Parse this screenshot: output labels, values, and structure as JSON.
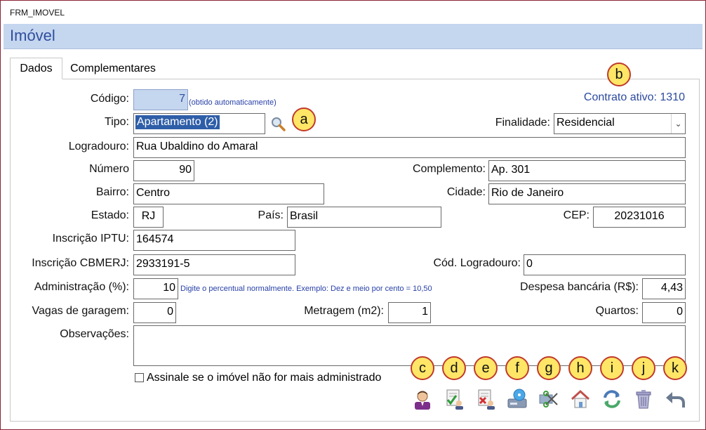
{
  "window": {
    "caption": "FRM_IMOVEL",
    "title": "Imóvel"
  },
  "tabs": [
    {
      "label": "Dados"
    },
    {
      "label": "Complementares"
    }
  ],
  "contract": {
    "text": "Contrato ativo: 1310"
  },
  "form": {
    "codigo": {
      "label": "Código:",
      "value": "7",
      "hint": "(obtido automaticamente)"
    },
    "tipo": {
      "label": "Tipo:",
      "value": "Apartamento (2)"
    },
    "finalidade": {
      "label": "Finalidade:",
      "value": "Residencial"
    },
    "logradouro": {
      "label": "Logradouro:",
      "value": "Rua Ubaldino do Amaral"
    },
    "numero": {
      "label": "Número",
      "value": "90"
    },
    "complemento": {
      "label": "Complemento:",
      "value": "Ap. 301"
    },
    "bairro": {
      "label": "Bairro:",
      "value": "Centro"
    },
    "cidade": {
      "label": "Cidade:",
      "value": "Rio de Janeiro"
    },
    "estado": {
      "label": "Estado:",
      "value": "RJ"
    },
    "pais": {
      "label": "País:",
      "value": "Brasil"
    },
    "cep": {
      "label": "CEP:",
      "value": "20231016"
    },
    "iptu": {
      "label": "Inscrição IPTU:",
      "value": "164574"
    },
    "cbmerj": {
      "label": "Inscrição CBMERJ:",
      "value": "2933191-5"
    },
    "cod_logradouro": {
      "label": "Cód. Logradouro:",
      "value": "0"
    },
    "administracao": {
      "label": "Administração (%):",
      "value": "10",
      "hint": "Digite o percentual normalmente. Exemplo: Dez e meio por cento = 10,50"
    },
    "despesa": {
      "label": "Despesa bancária (R$):",
      "value": "4,43"
    },
    "vagas": {
      "label": "Vagas de garagem:",
      "value": "0"
    },
    "metragem": {
      "label": "Metragem (m2):",
      "value": "1"
    },
    "quartos": {
      "label": "Quartos:",
      "value": "0"
    },
    "observacoes": {
      "label": "Observações:",
      "value": ""
    },
    "nao_administrado": {
      "label": "Assinale se o imóvel não for mais administrado",
      "checked": false
    }
  },
  "callouts": [
    "a",
    "b",
    "c",
    "d",
    "e",
    "f",
    "g",
    "h",
    "i",
    "j",
    "k"
  ],
  "toolbar": [
    {
      "icon": "person-icon"
    },
    {
      "icon": "approve-document-icon"
    },
    {
      "icon": "reject-document-icon"
    },
    {
      "icon": "save-disk-icon"
    },
    {
      "icon": "cut-icon"
    },
    {
      "icon": "home-icon"
    },
    {
      "icon": "refresh-icon"
    },
    {
      "icon": "trash-icon"
    },
    {
      "icon": "undo-arrow-icon"
    }
  ],
  "colors": {
    "accent": "#2f4f9e",
    "title_bar": "#c5d6ef",
    "callout_fill": "#ffe666",
    "callout_border": "#c0392b",
    "selection": "#2f5ea8"
  }
}
